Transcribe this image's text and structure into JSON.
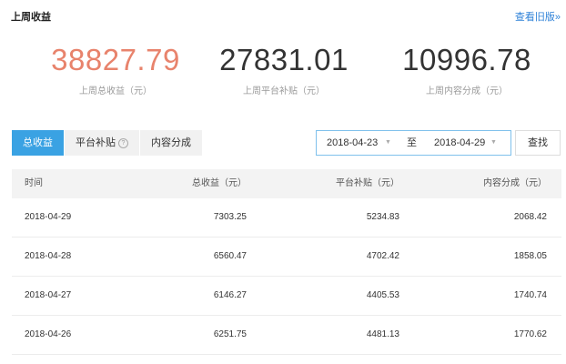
{
  "header": {
    "title": "上周收益",
    "old_version_link": "查看旧版»"
  },
  "stats": [
    {
      "value": "38827.79",
      "label": "上周总收益（元）",
      "color": "#e8836c"
    },
    {
      "value": "27831.01",
      "label": "上周平台补贴（元）",
      "color": "#333333"
    },
    {
      "value": "10996.78",
      "label": "上周内容分成（元）",
      "color": "#333333"
    }
  ],
  "tabs": [
    {
      "label": "总收益",
      "active": true
    },
    {
      "label": "平台补贴",
      "active": false,
      "help_icon": "?"
    },
    {
      "label": "内容分成",
      "active": false
    }
  ],
  "date_range": {
    "start": "2018-04-23",
    "separator": "至",
    "end": "2018-04-29"
  },
  "query_button": "查找",
  "table": {
    "columns": [
      "时间",
      "总收益（元）",
      "平台补贴（元）",
      "内容分成（元）"
    ],
    "rows": [
      [
        "2018-04-29",
        "7303.25",
        "5234.83",
        "2068.42"
      ],
      [
        "2018-04-28",
        "6560.47",
        "4702.42",
        "1858.05"
      ],
      [
        "2018-04-27",
        "6146.27",
        "4405.53",
        "1740.74"
      ],
      [
        "2018-04-26",
        "6251.75",
        "4481.13",
        "1770.62"
      ]
    ]
  },
  "colors": {
    "accent": "#3aa2e3",
    "link": "#2f82d8",
    "highlight_number": "#e8836c"
  }
}
